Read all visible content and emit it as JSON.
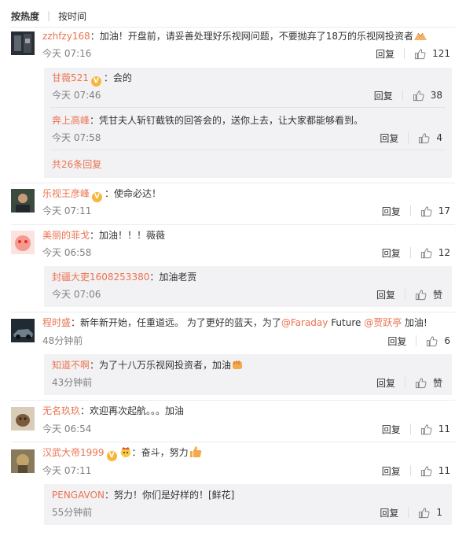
{
  "tabs": {
    "hot": "按热度",
    "time": "按时间"
  },
  "actions": {
    "reply": "回复",
    "zan": "赞"
  },
  "colors": {
    "accent": "#eb7350",
    "subbox": "#f2f2f5",
    "muted": "#808080"
  },
  "comments": [
    {
      "user": "zzhfzy168",
      "sep": "：",
      "text": "加油！开盘前，请妥善处理好乐视网问题，不要抛弃了18万的乐视网投资者",
      "emoji": "bow-hands-icon",
      "time": "今天 07:16",
      "likes": "121",
      "replies": [
        {
          "user": "甘薇521",
          "badge": "V",
          "sep": "：",
          "text": "会的",
          "time": "今天 07:46",
          "likes": "38"
        },
        {
          "user": "奔上高峰",
          "sep": "：",
          "text": "凭甘夫人斩钉截铁的回答会的，送你上去，让大家都能够看到。",
          "time": "今天 07:58",
          "likes": "4"
        }
      ],
      "more": "共26条回复"
    },
    {
      "user": "乐视王彦峰",
      "badge": "V",
      "sep": "：",
      "text": "使命必达！",
      "time": "今天 07:11",
      "likes": "17"
    },
    {
      "user": "美丽的菲戈",
      "sep": "：",
      "text": "加油！！！薇薇",
      "time": "今天 06:58",
      "likes": "12",
      "replies": [
        {
          "user": "封疆大吏1608253380",
          "sep": "：",
          "text": "加油老贾",
          "time": "今天 07:06",
          "likes": "赞"
        }
      ]
    },
    {
      "user": "程时盛",
      "sep": "：",
      "text_a": "新年新开始，任重道远。 为了更好的蓝天，为了",
      "mention_1": "@Faraday",
      "text_b": " Future ",
      "mention_2": "@贾跃亭",
      "text_c": " 加油!",
      "time": "48分钟前",
      "likes": "6",
      "replies": [
        {
          "user": "知道不啊",
          "sep": "：",
          "text": "为了十八万乐视网投资者，加油",
          "emoji": "fist-icon",
          "time": "43分钟前",
          "likes": "赞"
        }
      ]
    },
    {
      "user": "无名玖玖",
      "sep": "：",
      "text": "欢迎再次起航。。。加油",
      "time": "今天 06:54",
      "likes": "11"
    },
    {
      "user": "汉武大帝1999",
      "badge": "V",
      "sep": "：",
      "text_a": "奋斗，努力",
      "emoji_a": "crown-face-icon",
      "emoji_b": "thumbs-up-icon",
      "time": "今天 07:11",
      "likes": "11",
      "replies": [
        {
          "user": "PENGAVON",
          "sep": "：",
          "text": "努力！你们是好样的！[鲜花]",
          "time": "55分钟前",
          "likes": "1"
        }
      ]
    }
  ]
}
